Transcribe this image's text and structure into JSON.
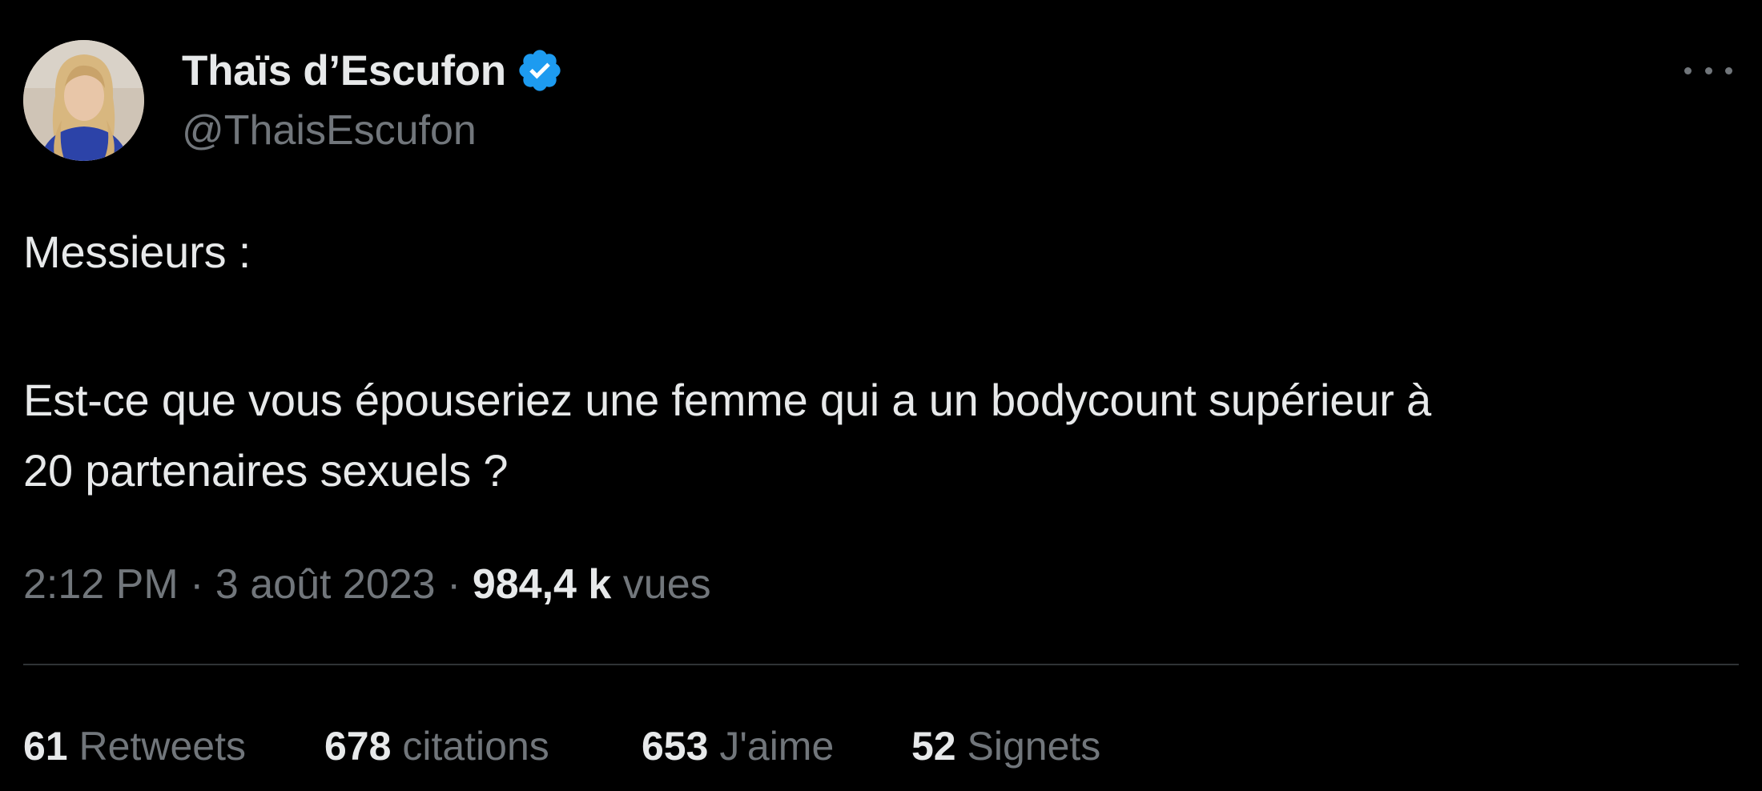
{
  "author": {
    "display_name": "Thaïs d’Escufon",
    "handle": "@ThaisEscufon",
    "verified_icon": "verified-badge-icon",
    "verified_color": "#1d9bf0"
  },
  "tweet": {
    "text_lines": [
      "Messieurs :",
      "Est-ce que vous épouseriez une femme qui a un bodycount supérieur à",
      "20 partenaires sexuels ?"
    ],
    "time": "2:12 PM",
    "separator": "·",
    "date": "3 août 2023",
    "views_count": "984,4 k",
    "views_label": "vues"
  },
  "stats": [
    {
      "count": "61",
      "label": "Retweets"
    },
    {
      "count": "678",
      "label": "citations"
    },
    {
      "count": "653",
      "label": "J'aime"
    },
    {
      "count": "52",
      "label": "Signets"
    }
  ],
  "menu": {
    "icon": "more-options-icon"
  },
  "colors": {
    "background": "#000000",
    "primary_text": "#e7e9ea",
    "secondary_text": "#71767b",
    "divider": "#2f3336"
  }
}
